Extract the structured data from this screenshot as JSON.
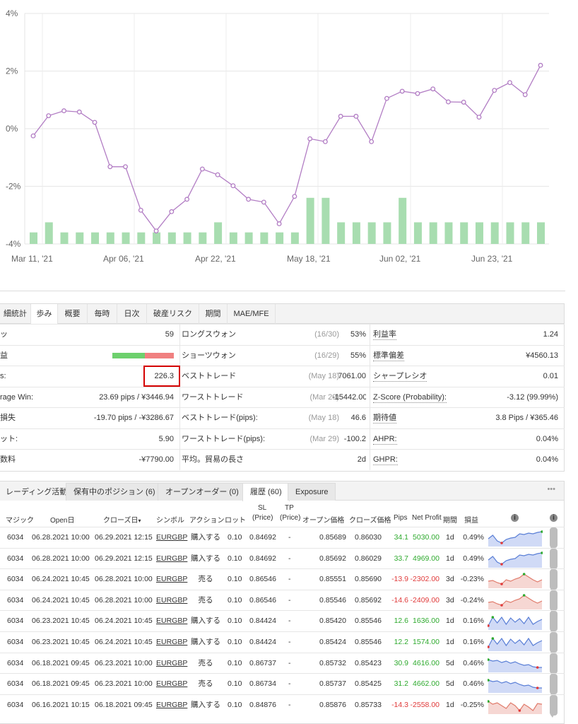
{
  "chart_data": {
    "type": "line+bar",
    "y_axis_labels": [
      "4%",
      "2%",
      "0%",
      "-2%",
      "-4%"
    ],
    "ylim": [
      -4,
      4
    ],
    "x_tick_labels": [
      "Mar 11, '21",
      "Apr 06, '21",
      "Apr 22, '21",
      "May 18, '21",
      "Jun 02, '21",
      "Jun 23, '21"
    ],
    "line_values": [
      -0.25,
      0.45,
      0.62,
      0.58,
      0.22,
      -1.32,
      -1.32,
      -2.83,
      -3.55,
      -2.88,
      -2.45,
      -1.4,
      -1.6,
      -1.98,
      -2.45,
      -2.55,
      -3.3,
      -2.35,
      -0.35,
      -0.45,
      0.43,
      0.43,
      -0.45,
      1.05,
      1.3,
      1.22,
      1.38,
      0.93,
      0.92,
      0.4,
      1.33,
      1.6,
      1.18,
      2.2
    ],
    "bar_values": [
      0.4,
      0.75,
      0.4,
      0.4,
      0.4,
      0.4,
      0.4,
      0.4,
      0.4,
      0.4,
      0.4,
      0.4,
      0.75,
      0.4,
      0.4,
      0.4,
      0.4,
      0.4,
      1.6,
      1.6,
      0.75,
      0.75,
      0.75,
      0.75,
      1.6,
      0.75,
      0.75,
      0.75,
      0.75,
      0.75,
      0.75,
      0.75,
      0.75,
      0.75
    ],
    "line_color": "#b27dc4",
    "bar_color": "#a8ddb0",
    "grid": true
  },
  "stats": {
    "tabs": [
      "細統計",
      "歩み",
      "概要",
      "毎時",
      "日次",
      "破産リスク",
      "期間",
      "MAE/MFE"
    ],
    "active_tab": "歩み",
    "rows": [
      {
        "l_label": "ッ",
        "l_value": "59",
        "m_label": "ロングスウォン",
        "m_gray": "(16/30)",
        "m_value": "53%",
        "r_label": "利益率",
        "r_value": "1.24"
      },
      {
        "l_label": "益",
        "l_value": "",
        "m_label": "ショーツウォン",
        "m_gray": "(16/29)",
        "m_value": "55%",
        "r_label": "標準偏差",
        "r_value": "¥4560.13"
      },
      {
        "l_label": "s:",
        "l_value": "226.3",
        "m_label": "ベストトレード",
        "m_gray": "(May 18)",
        "m_value": "7061.00",
        "r_label": "シャープレシオ",
        "r_value": "0.01"
      },
      {
        "l_label": "rage Win:",
        "l_value": "23.69 pips / ¥3446.94",
        "m_label": "ワーストトレード",
        "m_gray": "(Mar 29)",
        "m_value": "-15442.00",
        "r_label": "Z-Score (Probability):",
        "r_value": "-3.12 (99.99%)"
      },
      {
        "l_label": "損失",
        "l_value": "-19.70 pips / -¥3286.67",
        "m_label": "ベストトレード(pips):",
        "m_gray": "(May 18)",
        "m_value": "46.6",
        "r_label": "期待値",
        "r_value": "3.8 Pips / ¥365.46"
      },
      {
        "l_label": "ット:",
        "l_value": "5.90",
        "m_label": "ワーストトレード(pips):",
        "m_gray": "(Mar 29)",
        "m_value": "-100.2",
        "r_label": "AHPR:",
        "r_value": "0.04%"
      },
      {
        "l_label": "数料",
        "l_value": "-¥7790.00",
        "m_label": "平均。貿易の長さ",
        "m_gray": "",
        "m_value": "2d",
        "r_label": "GHPR:",
        "r_value": "0.04%"
      }
    ],
    "winloss_bar": {
      "win_fraction": 0.53,
      "win_color": "#6dd06d",
      "loss_color": "#f08080"
    }
  },
  "history": {
    "tabs": [
      "レーディング活動",
      "保有中のポジション (6)",
      "オープンオーダー (0)",
      "履歴 (60)",
      "Exposure"
    ],
    "active_tab": "履歴 (60)",
    "more_label": "•••",
    "headers": {
      "magic": "マジック",
      "open": "Open日",
      "close": "クローズ日",
      "sort_arrow": "▾",
      "symbol": "シンボル",
      "action": "アクション",
      "lot": "ロット",
      "sl": "SL",
      "sl_sub": "(Price)",
      "tp": "TP",
      "tp_sub": "(Price)",
      "open_price": "オープン価格",
      "close_price": "クローズ価格",
      "pips": "Pips",
      "net_profit": "Net Profit",
      "period": "期間",
      "pl": "損益",
      "info1": "i",
      "info2": "i"
    },
    "rows": [
      {
        "magic": "6034",
        "open": "06.28.2021 10:00",
        "close": "06.29.2021 12:15",
        "symbol": "EURGBP",
        "action": "購入する",
        "lot": "0.10",
        "sl": "0.84692",
        "tp": "-",
        "open_price": "0.85689",
        "close_price": "0.86030",
        "pips": "34.1",
        "profit": "5030.00",
        "period": "1d",
        "pl": "0.49%",
        "sign": "pos"
      },
      {
        "magic": "6034",
        "open": "06.28.2021 10:00",
        "close": "06.29.2021 12:15",
        "symbol": "EURGBP",
        "action": "購入する",
        "lot": "0.10",
        "sl": "0.84692",
        "tp": "-",
        "open_price": "0.85692",
        "close_price": "0.86029",
        "pips": "33.7",
        "profit": "4969.00",
        "period": "1d",
        "pl": "0.49%",
        "sign": "pos"
      },
      {
        "magic": "6034",
        "open": "06.24.2021 10:45",
        "close": "06.28.2021 10:00",
        "symbol": "EURGBP",
        "action": "売る",
        "lot": "0.10",
        "sl": "0.86546",
        "tp": "-",
        "open_price": "0.85551",
        "close_price": "0.85690",
        "pips": "-13.9",
        "profit": "-2302.00",
        "period": "3d",
        "pl": "-0.23%",
        "sign": "neg"
      },
      {
        "magic": "6034",
        "open": "06.24.2021 10:45",
        "close": "06.28.2021 10:00",
        "symbol": "EURGBP",
        "action": "売る",
        "lot": "0.10",
        "sl": "0.86546",
        "tp": "-",
        "open_price": "0.85546",
        "close_price": "0.85692",
        "pips": "-14.6",
        "profit": "-2409.00",
        "period": "3d",
        "pl": "-0.24%",
        "sign": "neg"
      },
      {
        "magic": "6034",
        "open": "06.23.2021 10:45",
        "close": "06.24.2021 10:45",
        "symbol": "EURGBP",
        "action": "購入する",
        "lot": "0.10",
        "sl": "0.84424",
        "tp": "-",
        "open_price": "0.85420",
        "close_price": "0.85546",
        "pips": "12.6",
        "profit": "1636.00",
        "period": "1d",
        "pl": "0.16%",
        "sign": "pos"
      },
      {
        "magic": "6034",
        "open": "06.23.2021 10:45",
        "close": "06.24.2021 10:45",
        "symbol": "EURGBP",
        "action": "購入する",
        "lot": "0.10",
        "sl": "0.84424",
        "tp": "-",
        "open_price": "0.85424",
        "close_price": "0.85546",
        "pips": "12.2",
        "profit": "1574.00",
        "period": "1d",
        "pl": "0.16%",
        "sign": "pos"
      },
      {
        "magic": "6034",
        "open": "06.18.2021 09:45",
        "close": "06.23.2021 10:00",
        "symbol": "EURGBP",
        "action": "売る",
        "lot": "0.10",
        "sl": "0.86737",
        "tp": "-",
        "open_price": "0.85732",
        "close_price": "0.85423",
        "pips": "30.9",
        "profit": "4616.00",
        "period": "5d",
        "pl": "0.46%",
        "sign": "pos"
      },
      {
        "magic": "6034",
        "open": "06.18.2021 09:45",
        "close": "06.23.2021 10:00",
        "symbol": "EURGBP",
        "action": "売る",
        "lot": "0.10",
        "sl": "0.86734",
        "tp": "-",
        "open_price": "0.85737",
        "close_price": "0.85425",
        "pips": "31.2",
        "profit": "4662.00",
        "period": "5d",
        "pl": "0.46%",
        "sign": "pos"
      },
      {
        "magic": "6034",
        "open": "06.16.2021 10:15",
        "close": "06.18.2021 09:45",
        "symbol": "EURGBP",
        "action": "購入する",
        "lot": "0.10",
        "sl": "0.84876",
        "tp": "-",
        "open_price": "0.85876",
        "close_price": "0.85733",
        "pips": "-14.3",
        "profit": "-2558.00",
        "period": "1d",
        "pl": "-0.25%",
        "sign": "neg"
      }
    ]
  },
  "colors": {
    "positive": "#2eaa2e",
    "negative": "#e03a3a",
    "highlight_box": "#d40000"
  }
}
